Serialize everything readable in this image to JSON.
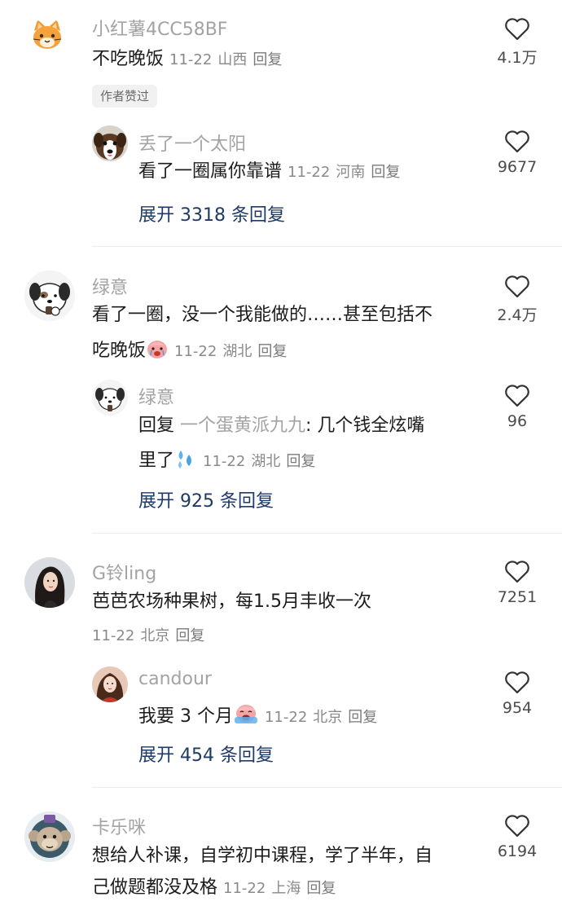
{
  "comments": [
    {
      "username": "小红薯4CC58BF",
      "text": "不吃晚饭",
      "date": "11-22",
      "location": "山西",
      "reply_label": "回复",
      "likes": "4.1万",
      "badge": "作者赞过",
      "avatar_icon": "cat-avatar-icon",
      "reply": {
        "username": "丢了一个太阳",
        "text": "看了一圈属你靠谱",
        "date": "11-22",
        "location": "河南",
        "reply_label": "回复",
        "likes": "9677",
        "avatar_icon": "dog-avatar-icon"
      },
      "expand_label": "展开 3318 条回复"
    },
    {
      "username": "绿意",
      "text_line1": "看了一圈，没一个我能做的……甚至包括不",
      "text_line2": "吃晚饭",
      "date": "11-22",
      "location": "湖北",
      "reply_label": "回复",
      "likes": "2.4万",
      "avatar_icon": "cartoon-dog-avatar-icon",
      "emoji_icon": "crying-emoji-icon",
      "reply": {
        "username": "绿意",
        "reply_prefix": "回复",
        "mention": "一个蛋黄派九九",
        "text_line1": ": 几个钱全炫嘴",
        "text_line2": "里了",
        "date": "11-22",
        "location": "湖北",
        "reply_label": "回复",
        "likes": "96",
        "avatar_icon": "cartoon-dog-avatar-icon",
        "emoji_icon": "sweat-drops-emoji-icon"
      },
      "expand_label": "展开 925 条回复"
    },
    {
      "username": "G铃ling",
      "text": "芭芭农场种果树，每1.5月丰收一次",
      "date": "11-22",
      "location": "北京",
      "reply_label": "回复",
      "likes": "7251",
      "avatar_icon": "woman-portrait-avatar-icon",
      "reply": {
        "username": "candour",
        "text": "我要 3 个月",
        "date": "11-22",
        "location": "北京",
        "reply_label": "回复",
        "likes": "954",
        "avatar_icon": "girl-portrait-avatar-icon",
        "emoji_icon": "sobbing-emoji-icon"
      },
      "expand_label": "展开 454 条回复"
    },
    {
      "username": "卡乐咪",
      "text_line1": "想给人补课，自学初中课程，学了半年，自",
      "text_line2": "己做题都没及格",
      "date": "11-22",
      "location": "上海",
      "reply_label": "回复",
      "likes": "6194",
      "avatar_icon": "monkey-avatar-icon"
    }
  ]
}
